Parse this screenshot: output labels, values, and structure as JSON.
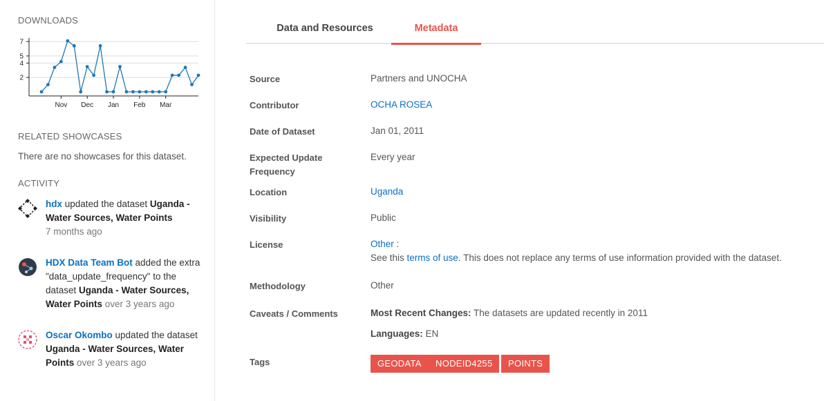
{
  "sidebar": {
    "downloads_title": "DOWNLOADS",
    "related_title": "RELATED SHOWCASES",
    "related_empty": "There are no showcases for this dataset.",
    "activity_title": "ACTIVITY",
    "activity": [
      {
        "actor": "hdx",
        "pre": " updated the dataset ",
        "dataset": "Uganda - Water Sources, Water Points",
        "post": "",
        "time": "7 months ago",
        "avatar_icon": "diamond-dots-avatar-icon"
      },
      {
        "actor": "HDX Data Team Bot",
        "pre": " added the extra \"data_update_frequency\" to the dataset ",
        "dataset": "Uganda - Water Sources, Water Points",
        "post": " ",
        "time": "over 3 years ago",
        "avatar_icon": "network-node-avatar-icon"
      },
      {
        "actor": "Oscar Okombo",
        "pre": " updated the dataset ",
        "dataset": "Uganda - Water Sources, Water Points",
        "post": " ",
        "time": "over 3 years ago",
        "avatar_icon": "pink-pattern-avatar-icon"
      }
    ]
  },
  "chart_data": {
    "type": "line",
    "title": "",
    "y_ticks": [
      2,
      4,
      5,
      7
    ],
    "ylim": [
      0,
      7.5
    ],
    "x_tick_labels": [
      "Nov",
      "Dec",
      "Jan",
      "Feb",
      "Mar"
    ],
    "values": [
      0,
      1,
      3.4,
      4.2,
      7.1,
      6.4,
      0,
      3.5,
      2.3,
      6.4,
      0,
      0,
      3.5,
      0,
      0,
      0,
      0,
      0,
      0,
      0,
      2.3,
      2.3,
      3.4,
      1,
      2.3
    ],
    "point_color": "#1f77b4",
    "grid": true
  },
  "tabs": [
    {
      "label": "Data and Resources",
      "active": false
    },
    {
      "label": "Metadata",
      "active": true
    }
  ],
  "metadata": {
    "source_label": "Source",
    "source_value": "Partners and UNOCHA",
    "contributor_label": "Contributor",
    "contributor_value": "OCHA ROSEA",
    "date_label": "Date of Dataset",
    "date_value": "Jan 01, 2011",
    "frequency_label": "Expected Update Frequency",
    "frequency_value": "Every year",
    "location_label": "Location",
    "location_value": "Uganda",
    "visibility_label": "Visibility",
    "visibility_value": "Public",
    "license_label": "License",
    "license_value": "Other",
    "license_colon": " :",
    "license_note_pre": "See this ",
    "license_note_link": "terms of use",
    "license_note_post": ". This does not replace any terms of use information provided with the dataset.",
    "methodology_label": "Methodology",
    "methodology_value": "Other",
    "caveats_label": "Caveats / Comments",
    "caveats_changes_label": "Most Recent Changes:",
    "caveats_changes_value": " The datasets are updated recently in 2011",
    "caveats_languages_label": "Languages:",
    "caveats_languages_value": " EN",
    "tags_label": "Tags",
    "tags": [
      "GEODATA",
      "NODEID4255",
      "POINTS"
    ]
  },
  "colors": {
    "accent": "#e8544b",
    "link": "#0b6fc4"
  }
}
